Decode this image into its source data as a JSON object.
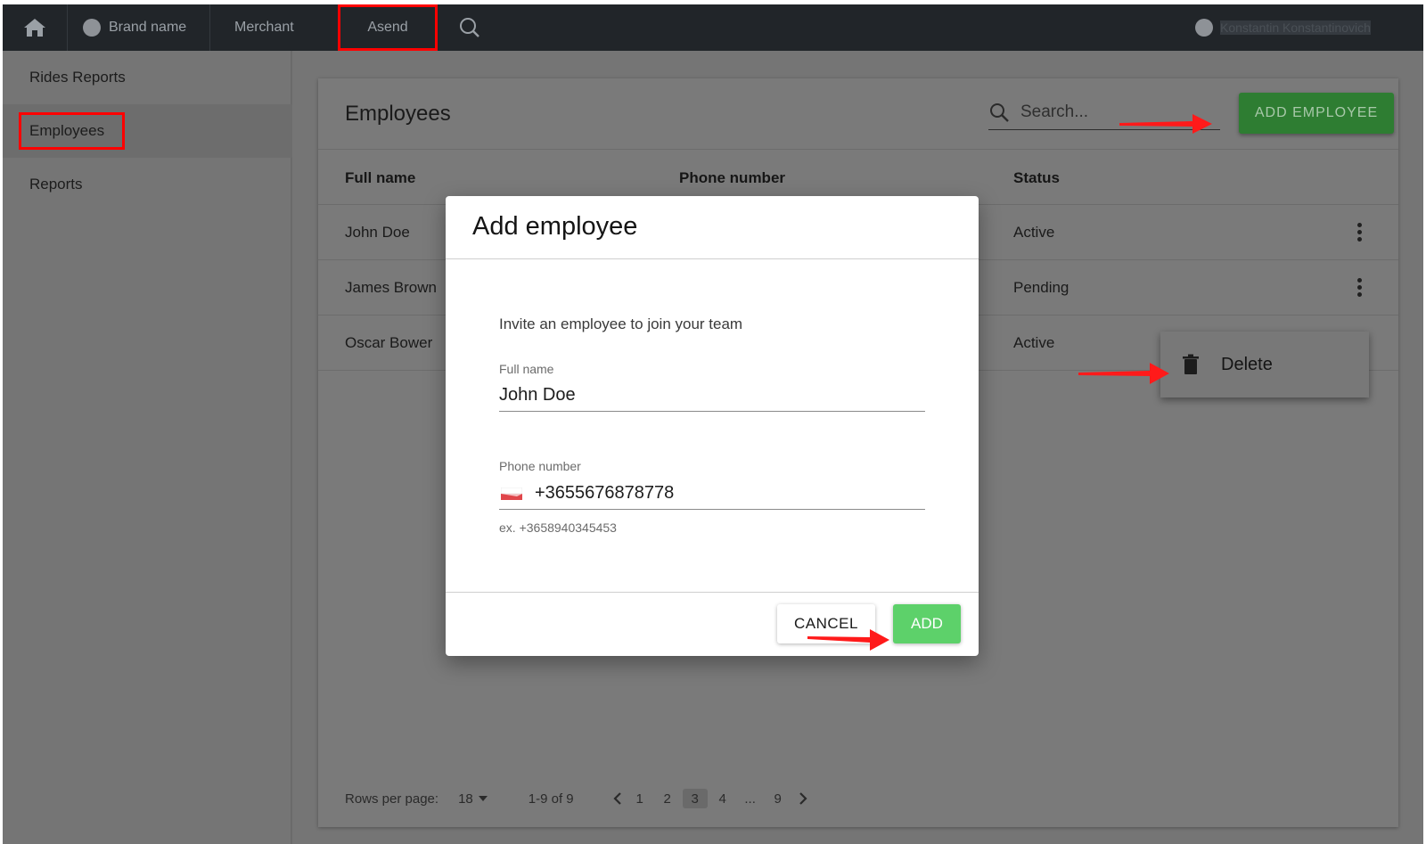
{
  "topbar": {
    "brand_label": "Brand name",
    "merchant_label": "Merchant",
    "asend_label": "Asend",
    "user_name": "Konstantin Konstantinovich"
  },
  "sidebar": {
    "items": [
      {
        "label": "Rides Reports"
      },
      {
        "label": "Employees"
      },
      {
        "label": "Reports"
      }
    ]
  },
  "employees": {
    "title": "Employees",
    "search_placeholder": "Search...",
    "add_button": "ADD EMPLOYEE",
    "columns": [
      "Full name",
      "Phone number",
      "Status"
    ],
    "rows": [
      {
        "name": "John Doe",
        "status": "Active"
      },
      {
        "name": "James Brown",
        "status": "Pending"
      },
      {
        "name": "Oscar Bower",
        "status": "Active"
      }
    ],
    "row_menu": {
      "delete_label": "Delete"
    },
    "pagination": {
      "rows_per_page_label": "Rows per page:",
      "rows_per_page_value": "18",
      "range": "1-9 of 9",
      "pages": [
        "1",
        "2",
        "3",
        "4",
        "...",
        "9"
      ],
      "current_page": "3"
    }
  },
  "modal": {
    "title": "Add employee",
    "description": "Invite an employee to join your team",
    "full_name_label": "Full name",
    "full_name_value": "John Doe",
    "phone_label": "Phone number",
    "phone_value": "+3655676878778",
    "phone_hint": "ex. +3658940345453",
    "cancel_label": "CANCEL",
    "add_label": "ADD"
  },
  "colors": {
    "topbar": "#212529",
    "overlay_gray": "#757575",
    "add_employee_green": "#2e7d32",
    "add_green": "#5dd16a",
    "highlight_red": "#ff0000"
  }
}
